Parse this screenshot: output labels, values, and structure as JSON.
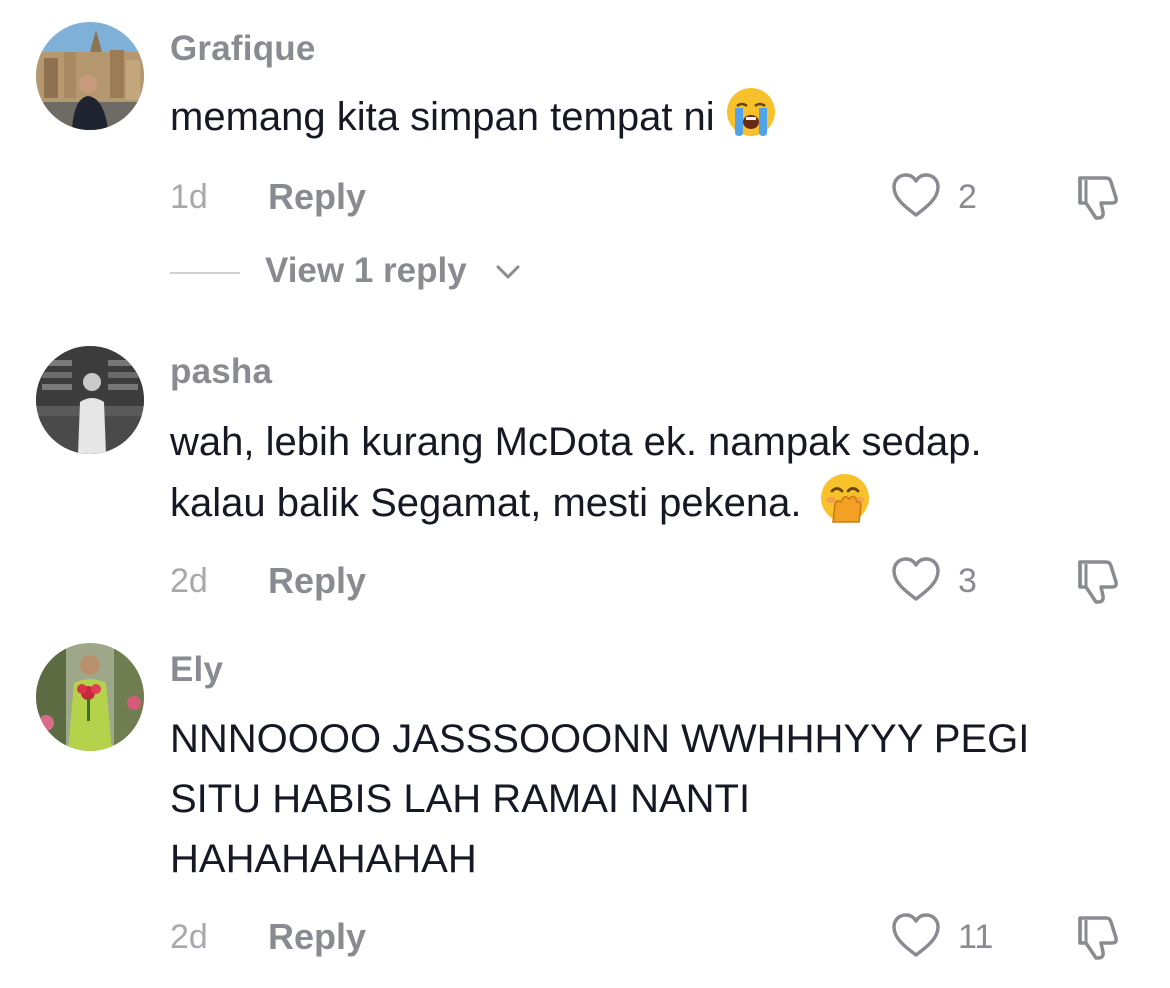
{
  "comments": [
    {
      "username": "Grafique",
      "text": "memang kita simpan tempat ni",
      "emoji": "loudly-crying-face",
      "time": "1d",
      "reply_label": "Reply",
      "likes": "2",
      "view_replies": "View 1 reply"
    },
    {
      "username": "pasha",
      "text_line1": "wah, lebih kurang McDota ek. nampak sedap.",
      "text_line2": "kalau balik Segamat, mesti pekena.",
      "emoji": "face-with-hand-over-mouth",
      "time": "2d",
      "reply_label": "Reply",
      "likes": "3"
    },
    {
      "username": "Ely",
      "text_line1": "NNNOOOO JASSSOOONN WWHHHYYY PEGI",
      "text_line2": "SITU HABIS LAH RAMAI NANTI",
      "text_line3": "HAHAHAHAHAH",
      "time": "2d",
      "reply_label": "Reply",
      "likes": "11"
    }
  ],
  "icons": {
    "like": "heart-outline-icon",
    "dislike": "thumbs-down-icon",
    "expand": "chevron-down-icon"
  },
  "colors": {
    "text": "#161823",
    "secondary": "#8a8b91",
    "time": "#a7a8ad"
  }
}
